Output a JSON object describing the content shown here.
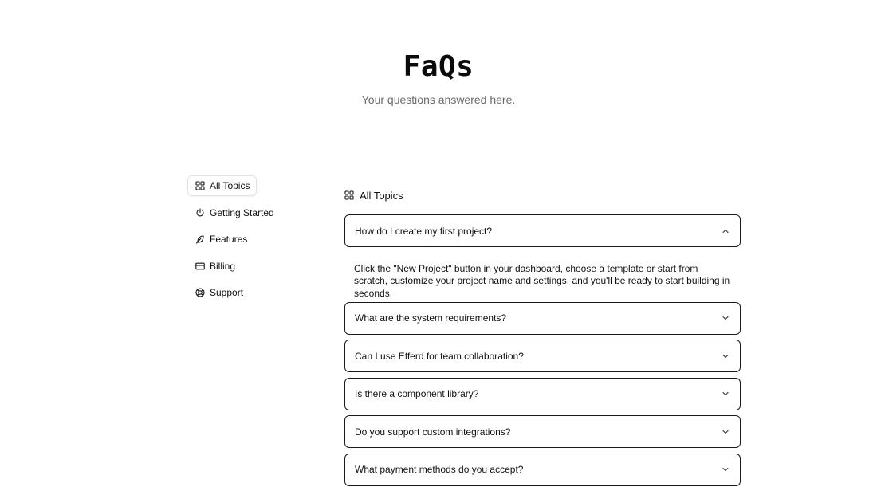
{
  "hero": {
    "title": "FaQs",
    "subtitle": "Your questions answered here."
  },
  "sidebar": {
    "items": [
      {
        "label": "All Topics",
        "icon": "grid-icon",
        "active": true
      },
      {
        "label": "Getting Started",
        "icon": "power-icon",
        "active": false
      },
      {
        "label": "Features",
        "icon": "feather-icon",
        "active": false
      },
      {
        "label": "Billing",
        "icon": "credit-card-icon",
        "active": false
      },
      {
        "label": "Support",
        "icon": "life-buoy-icon",
        "active": false
      }
    ]
  },
  "main": {
    "heading": "All Topics",
    "heading_icon": "grid-icon",
    "faqs": [
      {
        "question": "How do I create my first project?",
        "expanded": true,
        "answer": "Click the \"New Project\" button in your dashboard, choose a template or start from scratch, customize your project name and settings, and you'll be ready to start building in seconds."
      },
      {
        "question": "What are the system requirements?",
        "expanded": false
      },
      {
        "question": "Can I use Efferd for team collaboration?",
        "expanded": false
      },
      {
        "question": "Is there a component library?",
        "expanded": false
      },
      {
        "question": "Do you support custom integrations?",
        "expanded": false
      },
      {
        "question": "What payment methods do you accept?",
        "expanded": false
      }
    ]
  },
  "colors": {
    "text": "#111111",
    "muted": "#6b6b6b",
    "border": "#1a1a1a",
    "active_border": "#e2e2e2",
    "background": "#ffffff"
  }
}
